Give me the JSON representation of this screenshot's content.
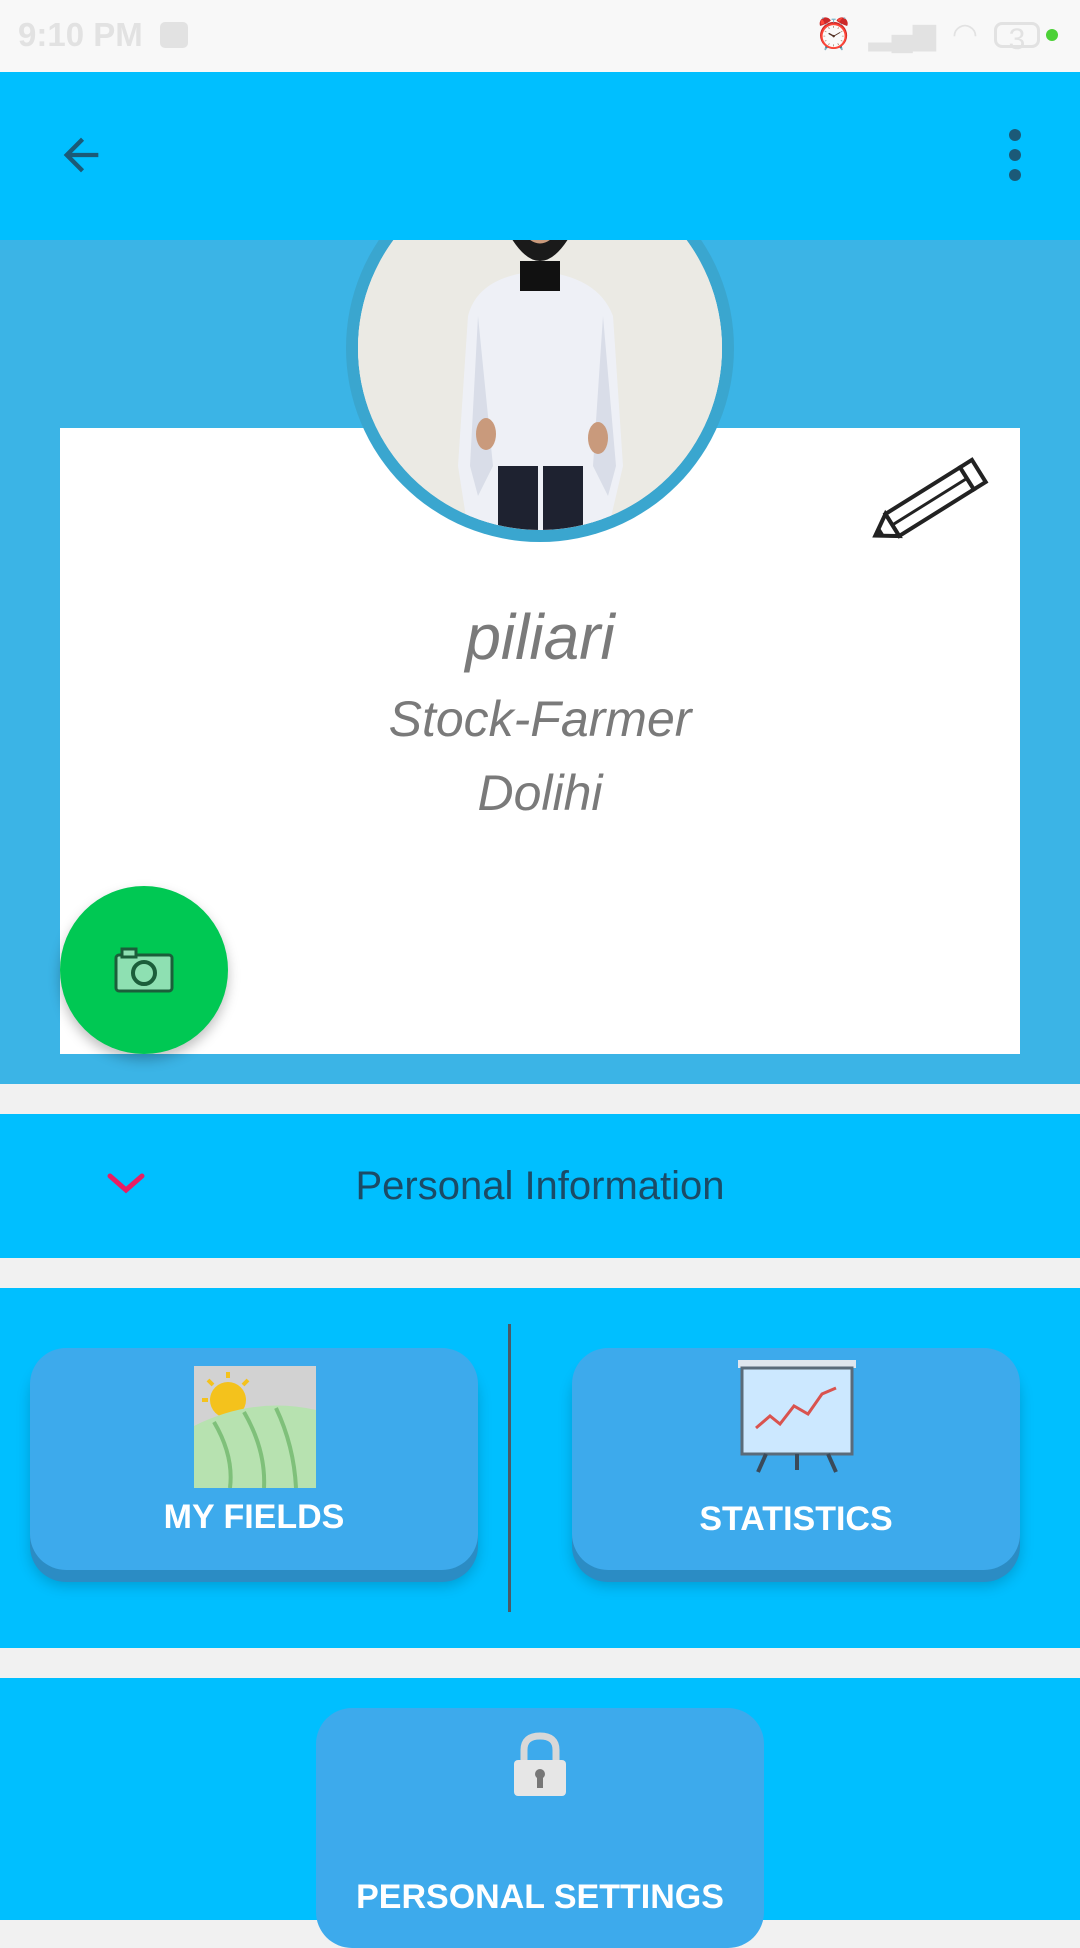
{
  "status_bar": {
    "time": "9:10 PM",
    "battery": "3"
  },
  "app_bar": {
    "back_icon": "arrow-left-icon",
    "menu_icon": "more-vert-icon"
  },
  "profile": {
    "name": "piliari",
    "role": "Stock-Farmer",
    "location": "Dolihi",
    "edit_icon": "pencil-icon",
    "camera_icon": "camera-icon"
  },
  "personal_info": {
    "label": "Personal Information",
    "chevron_icon": "chevron-down-icon",
    "chevron_color": "#e91e63"
  },
  "actions": {
    "my_fields_label": "MY FIELDS",
    "statistics_label": "STATISTICS"
  },
  "settings": {
    "label": "PERSONAL SETTINGS",
    "lock_icon": "lock-icon"
  },
  "colors": {
    "app_bar": "#00bfff",
    "profile_bg": "#3bb4e6",
    "card_button": "#3daaec",
    "fab": "#00c853"
  }
}
